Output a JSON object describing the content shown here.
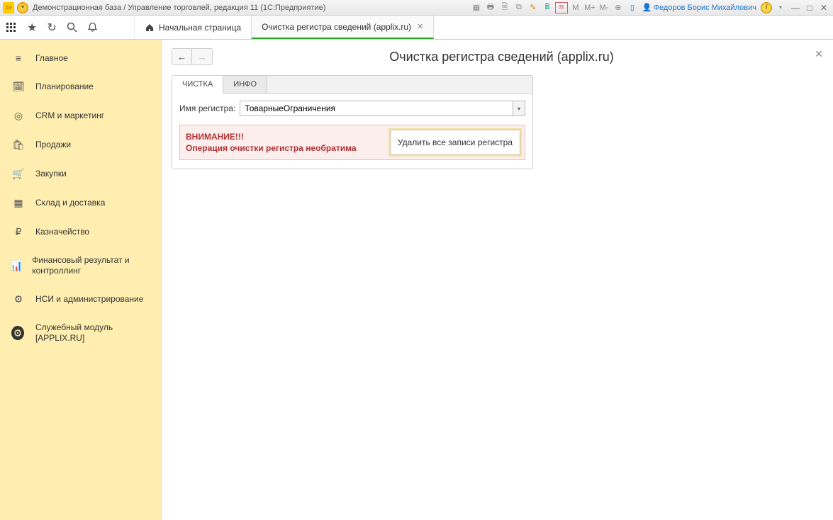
{
  "titlebar": {
    "app_badge": "1e",
    "title": "Демонстрационная база / Управление торговлей, редакция 11  (1С:Предприятие)",
    "user_name": "Федоров Борис Михайлович",
    "mem_labels": {
      "m": "M",
      "mplus": "M+",
      "mminus": "M-"
    },
    "cal_label": "31"
  },
  "tabs": {
    "home_label": "Начальная страница",
    "active_label": "Очистка регистра сведений (applix.ru)"
  },
  "sidebar": {
    "items": [
      {
        "label": "Главное"
      },
      {
        "label": "Планирование"
      },
      {
        "label": "CRM и маркетинг"
      },
      {
        "label": "Продажи"
      },
      {
        "label": "Закупки"
      },
      {
        "label": "Склад и доставка"
      },
      {
        "label": "Казначейство"
      },
      {
        "label": "Финансовый результат и контроллинг"
      },
      {
        "label": "НСИ и администрирование"
      },
      {
        "label": "Служебный модуль [APPLIX.RU]"
      }
    ]
  },
  "page": {
    "title": "Очистка регистра сведений (applix.ru)",
    "tab_clean": "ЧИСТКА",
    "tab_info": "ИНФО",
    "field_label": "Имя регистра:",
    "field_value": "ТоварныеОграничения",
    "warn_line1": "ВНИМАНИЕ!!!",
    "warn_line2": "Операция очистки регистра необратима",
    "delete_btn": "Удалить все записи регистра"
  }
}
